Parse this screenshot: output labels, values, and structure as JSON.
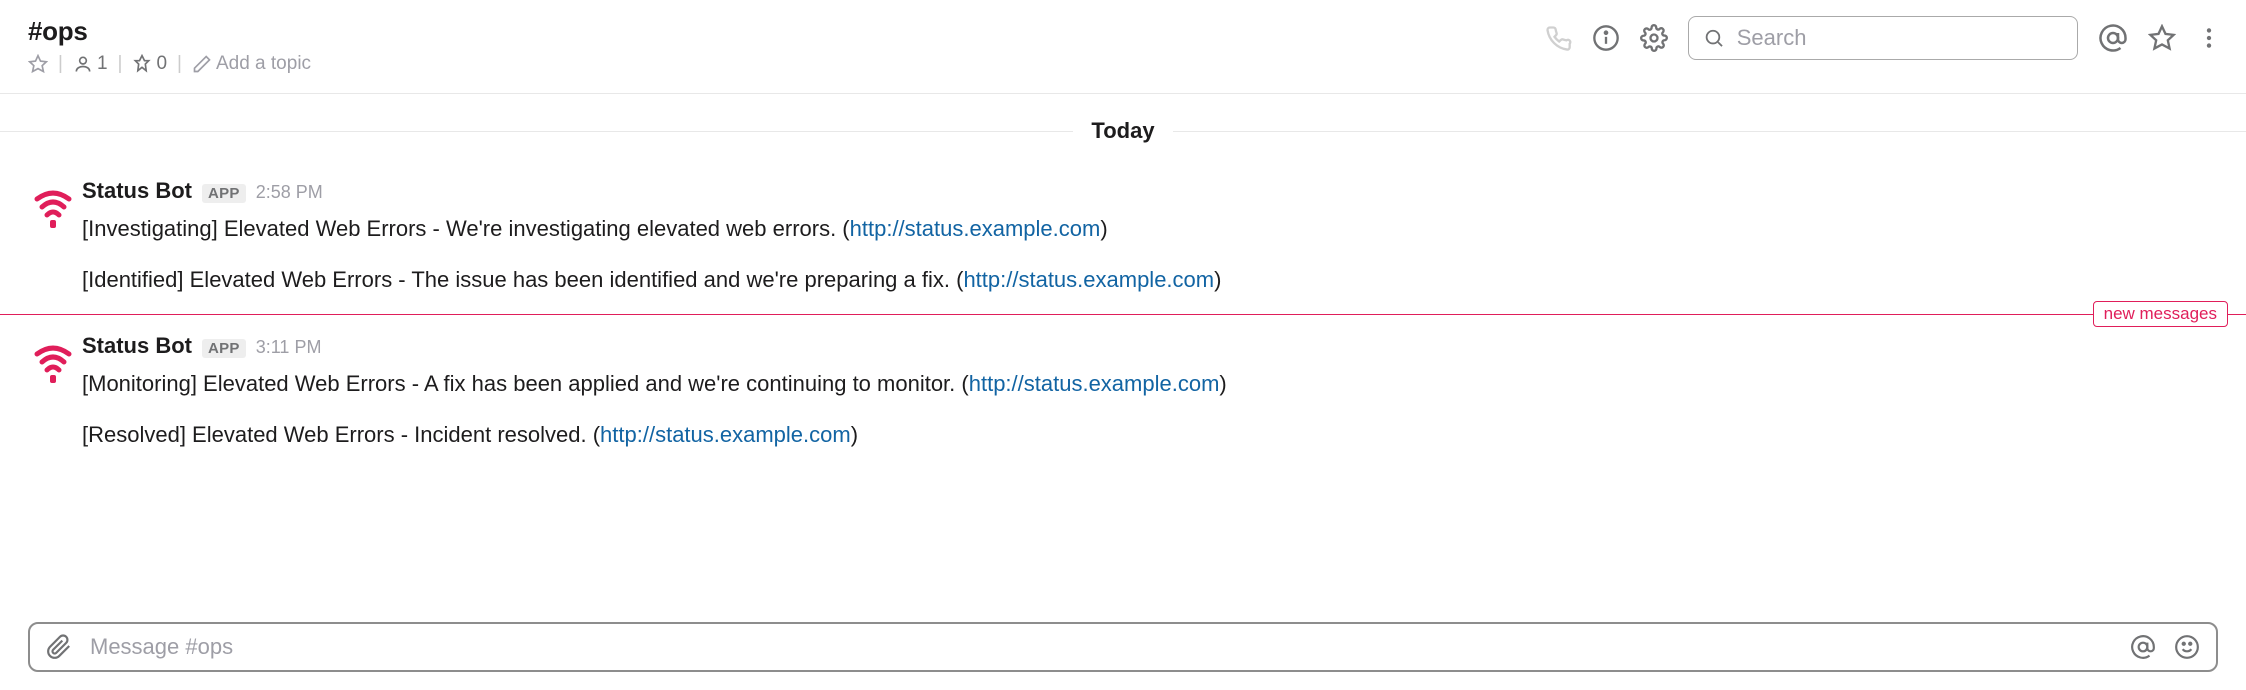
{
  "channel": {
    "name": "#ops",
    "member_count": "1",
    "pin_count": "0",
    "topic_placeholder": "Add a topic"
  },
  "search": {
    "placeholder": "Search"
  },
  "date_divider": "Today",
  "new_divider_label": "new messages",
  "app_badge": "APP",
  "blocks": [
    {
      "sender": "Status Bot",
      "timestamp": "2:58 PM",
      "messages": [
        {
          "text_pre": "[Investigating] Elevated Web Errors - We're investigating elevated web errors. (",
          "link": "http://status.example.com",
          "text_post": ")"
        },
        {
          "text_pre": "[Identified] Elevated Web Errors - The issue has been identified and we're preparing a fix. (",
          "link": "http://status.example.com",
          "text_post": ")"
        }
      ]
    },
    {
      "sender": "Status Bot",
      "timestamp": "3:11 PM",
      "messages": [
        {
          "text_pre": "[Monitoring] Elevated Web Errors - A fix has been applied and we're continuing to monitor. (",
          "link": "http://status.example.com",
          "text_post": ")"
        },
        {
          "text_pre": "[Resolved] Elevated Web Errors - Incident resolved. (",
          "link": "http://status.example.com",
          "text_post": ")"
        }
      ]
    }
  ],
  "composer": {
    "placeholder": "Message #ops"
  }
}
